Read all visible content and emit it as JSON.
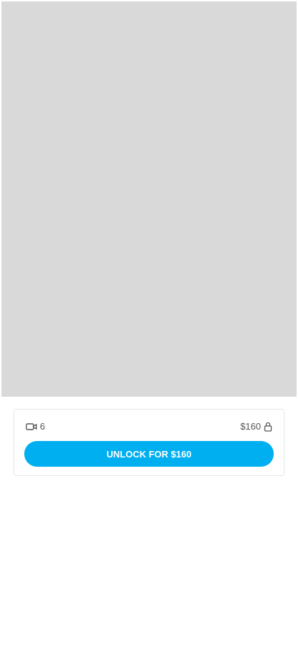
{
  "post": {
    "video_count": "6",
    "price": "$160",
    "unlock_label": "UNLOCK FOR $160"
  }
}
